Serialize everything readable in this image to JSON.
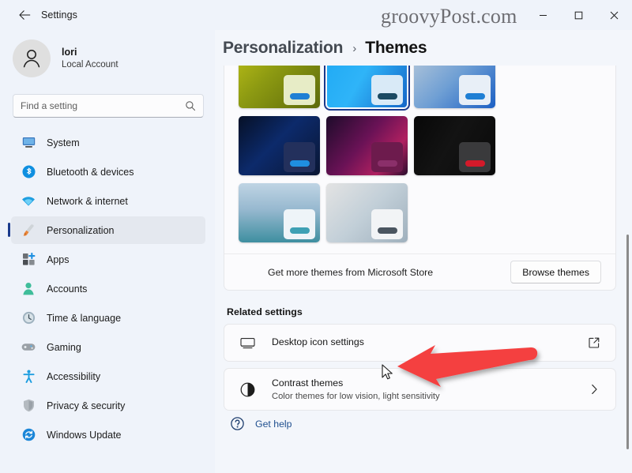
{
  "window": {
    "title": "Settings",
    "back_icon": "arrow-left-icon",
    "controls": {
      "minimize": "minimize-icon",
      "maximize": "maximize-icon",
      "close": "close-icon"
    }
  },
  "watermark": "groovyPost.com",
  "account": {
    "name": "lori",
    "subtitle": "Local Account",
    "avatar_icon": "person-icon"
  },
  "search": {
    "placeholder": "Find a setting",
    "value": "",
    "icon": "search-icon"
  },
  "sidebar": {
    "items": [
      {
        "label": "System",
        "icon": "system-icon",
        "active": false
      },
      {
        "label": "Bluetooth & devices",
        "icon": "bluetooth-icon",
        "active": false
      },
      {
        "label": "Network & internet",
        "icon": "wifi-icon",
        "active": false
      },
      {
        "label": "Personalization",
        "icon": "paintbrush-icon",
        "active": true
      },
      {
        "label": "Apps",
        "icon": "apps-icon",
        "active": false
      },
      {
        "label": "Accounts",
        "icon": "accounts-icon",
        "active": false
      },
      {
        "label": "Time & language",
        "icon": "clock-icon",
        "active": false
      },
      {
        "label": "Gaming",
        "icon": "gamepad-icon",
        "active": false
      },
      {
        "label": "Accessibility",
        "icon": "accessibility-icon",
        "active": false
      },
      {
        "label": "Privacy & security",
        "icon": "shield-icon",
        "active": false
      },
      {
        "label": "Windows Update",
        "icon": "update-icon",
        "active": false
      }
    ]
  },
  "breadcrumb": {
    "parent": "Personalization",
    "separator": "›",
    "current": "Themes"
  },
  "themes": {
    "tiles": [
      {
        "name": "theme-tile-1",
        "selected": false,
        "bg": "linear-gradient(135deg,#b9bd17 0%,#8d9a12 40%,#5d6a0a 100%)",
        "win_bg": "#e7ecc6",
        "bar_bg": "#1f7fd4"
      },
      {
        "name": "theme-tile-2",
        "selected": true,
        "bg": "linear-gradient(120deg,#1fa9f4 0%,#2fb4f8 45%,#1565c7 100%)",
        "win_bg": "#d9eaf7",
        "bar_bg": "#1b4a63"
      },
      {
        "name": "theme-tile-3",
        "selected": false,
        "bg": "linear-gradient(135deg,#b7c9da 0%,#6f9fd4 50%,#1b5fc4 100%)",
        "win_bg": "#e8eff7",
        "bar_bg": "#1f7fd4"
      },
      {
        "name": "theme-tile-4",
        "selected": false,
        "bg": "linear-gradient(135deg,#061026 0%,#0c2a6b 45%,#0a1633 100%)",
        "win_bg": "#23305c",
        "bar_bg": "#1f8fe0"
      },
      {
        "name": "theme-tile-5",
        "selected": false,
        "bg": "linear-gradient(130deg,#1d0b2a 0%,#6a1256 45%,#b02060 75%,#2a0d2e 100%)",
        "win_bg": "#6d1b4d",
        "bar_bg": "#8b2f6a"
      },
      {
        "name": "theme-tile-6",
        "selected": false,
        "bg": "linear-gradient(120deg,#080808 0%,#131313 45%,#0a0a0a 100%)",
        "win_bg": "#3a3a3c",
        "bar_bg": "#d41a2a"
      },
      {
        "name": "theme-tile-7",
        "selected": false,
        "bg": "linear-gradient(180deg,#bfd4e4 0%,#96b8cf 45%,#3e8fa0 100%)",
        "win_bg": "#eef4f8",
        "bar_bg": "#3ea0b4"
      },
      {
        "name": "theme-tile-8",
        "selected": false,
        "bg": "linear-gradient(135deg,#e3e3e3 0%,#c2cfd8 50%,#9fb0bd 100%)",
        "win_bg": "#f2f4f6",
        "bar_bg": "#4a5560"
      }
    ],
    "store_label": "Get more themes from Microsoft Store",
    "browse_button": "Browse themes"
  },
  "related": {
    "title": "Related settings",
    "rows": [
      {
        "title": "Desktop icon settings",
        "subtitle": "",
        "icon": "monitor-icon",
        "affordance": "external-link-icon"
      },
      {
        "title": "Contrast themes",
        "subtitle": "Color themes for low vision, light sensitivity",
        "icon": "contrast-icon",
        "affordance": "chevron-right-icon"
      }
    ]
  },
  "get_help": {
    "label": "Get help",
    "icon": "help-icon"
  },
  "annotation": {
    "arrow_color": "#f43f3f",
    "cursor_icon": "mouse-pointer-icon"
  },
  "colors": {
    "sidebar_bg": "#eff3fa",
    "content_bg": "#f3f6fb",
    "card_bg": "#fbfbfd",
    "accent": "#1b3a8c",
    "link": "#1f4f8f"
  }
}
